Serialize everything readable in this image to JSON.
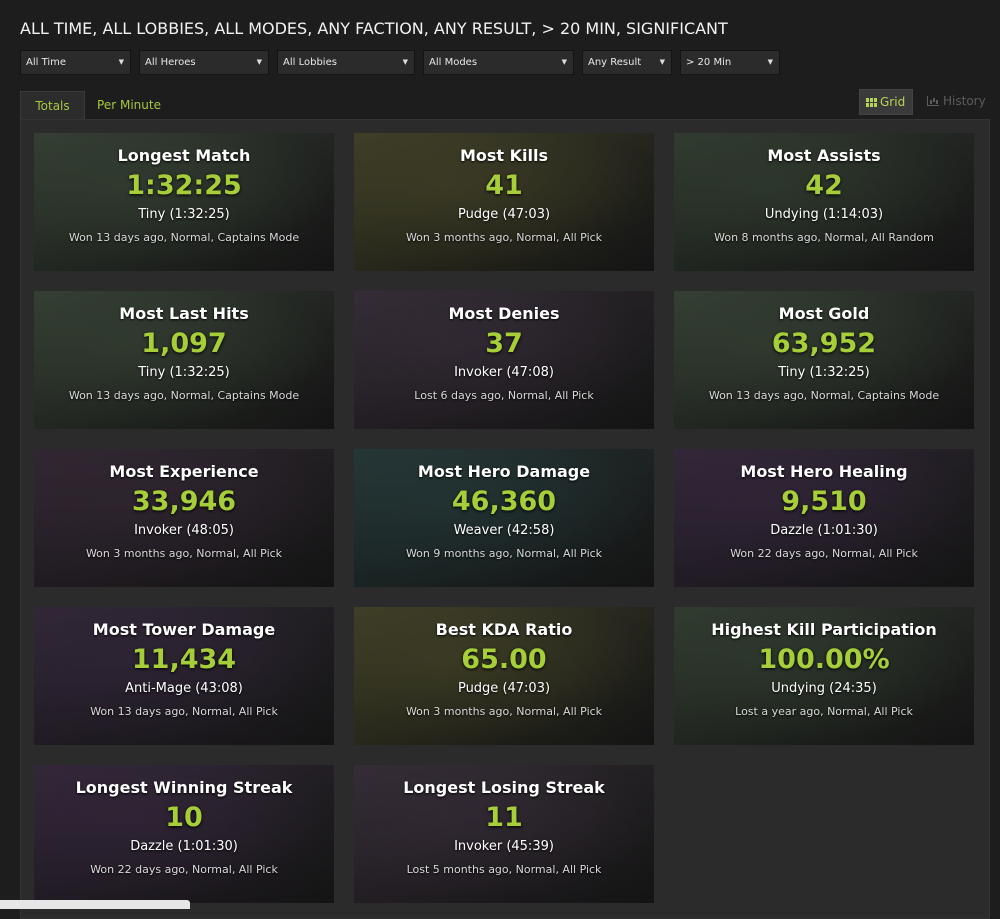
{
  "page_title": "ALL TIME, ALL LOBBIES, ALL MODES, ANY FACTION, ANY RESULT, > 20 MIN, SIGNIFICANT",
  "filters": [
    {
      "label": "All Time"
    },
    {
      "label": "All Heroes"
    },
    {
      "label": "All Lobbies"
    },
    {
      "label": "All Modes"
    },
    {
      "label": "Any Result"
    },
    {
      "label": "> 20 Min"
    }
  ],
  "tabs": [
    {
      "label": "Totals",
      "active": true
    },
    {
      "label": "Per Minute",
      "active": false
    }
  ],
  "view": {
    "grid_label": "Grid",
    "history_label": "History"
  },
  "colors": {
    "accent": "#a6ce39",
    "background": "#1d1d1d",
    "panel": "#2b2b2b"
  },
  "records": [
    {
      "label": "Longest Match",
      "value": "1:32:25",
      "hero": "Tiny (1:32:25)",
      "meta": "Won 13 days ago, Normal, Captains Mode",
      "tint": "#3e4a3c"
    },
    {
      "label": "Most Kills",
      "value": "41",
      "hero": "Pudge (47:03)",
      "meta": "Won 3 months ago, Normal, All Pick",
      "tint": "#4a4a2e"
    },
    {
      "label": "Most Assists",
      "value": "42",
      "hero": "Undying (1:14:03)",
      "meta": "Won 8 months ago, Normal, All Random",
      "tint": "#3a4638"
    },
    {
      "label": "Most Last Hits",
      "value": "1,097",
      "hero": "Tiny (1:32:25)",
      "meta": "Won 13 days ago, Normal, Captains Mode",
      "tint": "#3e4a3c"
    },
    {
      "label": "Most Denies",
      "value": "37",
      "hero": "Invoker (47:08)",
      "meta": "Lost 6 days ago, Normal, All Pick",
      "tint": "#3e3440"
    },
    {
      "label": "Most Gold",
      "value": "63,952",
      "hero": "Tiny (1:32:25)",
      "meta": "Won 13 days ago, Normal, Captains Mode",
      "tint": "#3e4a3c"
    },
    {
      "label": "Most Experience",
      "value": "33,946",
      "hero": "Invoker (48:05)",
      "meta": "Won 3 months ago, Normal, All Pick",
      "tint": "#3a2e3c"
    },
    {
      "label": "Most Hero Damage",
      "value": "46,360",
      "hero": "Weaver (42:58)",
      "meta": "Won 9 months ago, Normal, All Pick",
      "tint": "#2c4040"
    },
    {
      "label": "Most Hero Healing",
      "value": "9,510",
      "hero": "Dazzle (1:01:30)",
      "meta": "Won 22 days ago, Normal, All Pick",
      "tint": "#3c2e44"
    },
    {
      "label": "Most Tower Damage",
      "value": "11,434",
      "hero": "Anti-Mage (43:08)",
      "meta": "Won 13 days ago, Normal, All Pick",
      "tint": "#3a2e42"
    },
    {
      "label": "Best KDA Ratio",
      "value": "65.00",
      "hero": "Pudge (47:03)",
      "meta": "Won 3 months ago, Normal, All Pick",
      "tint": "#4a4a2e"
    },
    {
      "label": "Highest Kill Participation",
      "value": "100.00%",
      "hero": "Undying (24:35)",
      "meta": "Lost a year ago, Normal, All Pick",
      "tint": "#3a4638"
    },
    {
      "label": "Longest Winning Streak",
      "value": "10",
      "hero": "Dazzle (1:01:30)",
      "meta": "Won 22 days ago, Normal, All Pick",
      "tint": "#3c2e44"
    },
    {
      "label": "Longest Losing Streak",
      "value": "11",
      "hero": "Invoker (45:39)",
      "meta": "Lost 5 months ago, Normal, All Pick",
      "tint": "#3e3440"
    }
  ]
}
